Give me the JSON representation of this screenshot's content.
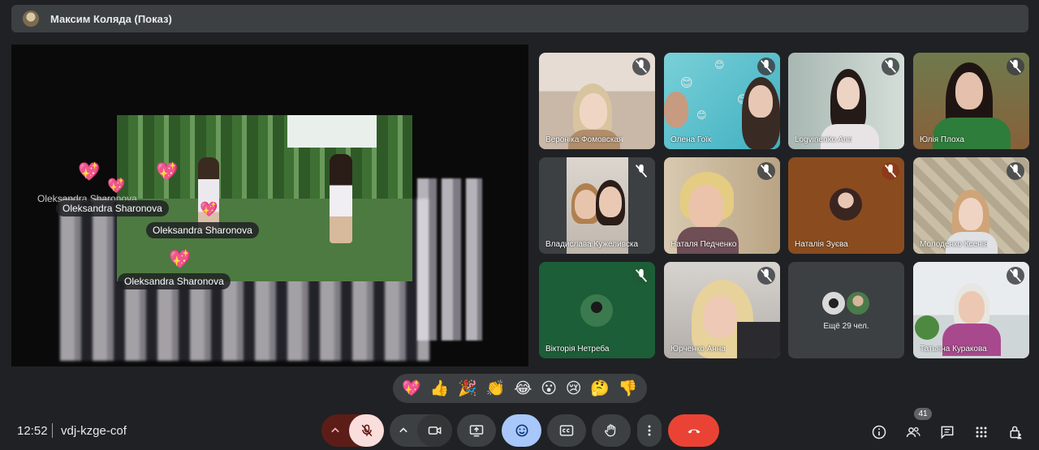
{
  "presenter_bar": {
    "title": "Максим Коляда (Показ)"
  },
  "presentation": {
    "reaction_names": [
      "Oleksandra Sharonova",
      "Oleksandra Sharonova",
      "Oleksandra Sharonova",
      "Oleksandra Sharonova"
    ]
  },
  "participants": [
    {
      "name": "Вероніка Фомовская",
      "mic": "muted"
    },
    {
      "name": "Олена Гоїк",
      "mic": "muted"
    },
    {
      "name": "Logvinenko Ann",
      "mic": "muted"
    },
    {
      "name": "Юлія Плоха",
      "mic": "muted"
    },
    {
      "name": "Владислава Кужеливска",
      "mic": "muted"
    },
    {
      "name": "Наталя Педченко",
      "mic": "muted"
    },
    {
      "name": "Наталія Зуєва",
      "mic": "muted"
    },
    {
      "name": "Молоденко Ксенія",
      "mic": "muted"
    },
    {
      "name": "Вікторія Нетреба",
      "mic": "muted"
    },
    {
      "name": "Юрченко Анна",
      "mic": "muted"
    },
    {
      "name": "Ещё 29 чел.",
      "mic": "muted"
    },
    {
      "name": "Татьяна Куракова",
      "mic": "muted"
    }
  ],
  "reactions": [
    "💖",
    "👍",
    "🎉",
    "👏",
    "😂",
    "😮",
    "😢",
    "🤔",
    "👎"
  ],
  "controls": {
    "time": "12:52",
    "meeting_code": "vdj-kzge-cof",
    "people_count": "41"
  },
  "colors": {
    "background": "#202124",
    "surface": "#3c4043",
    "end_call": "#ea4335",
    "mic_off": "#f9dedc",
    "reactions_active": "#a8c7fa"
  }
}
